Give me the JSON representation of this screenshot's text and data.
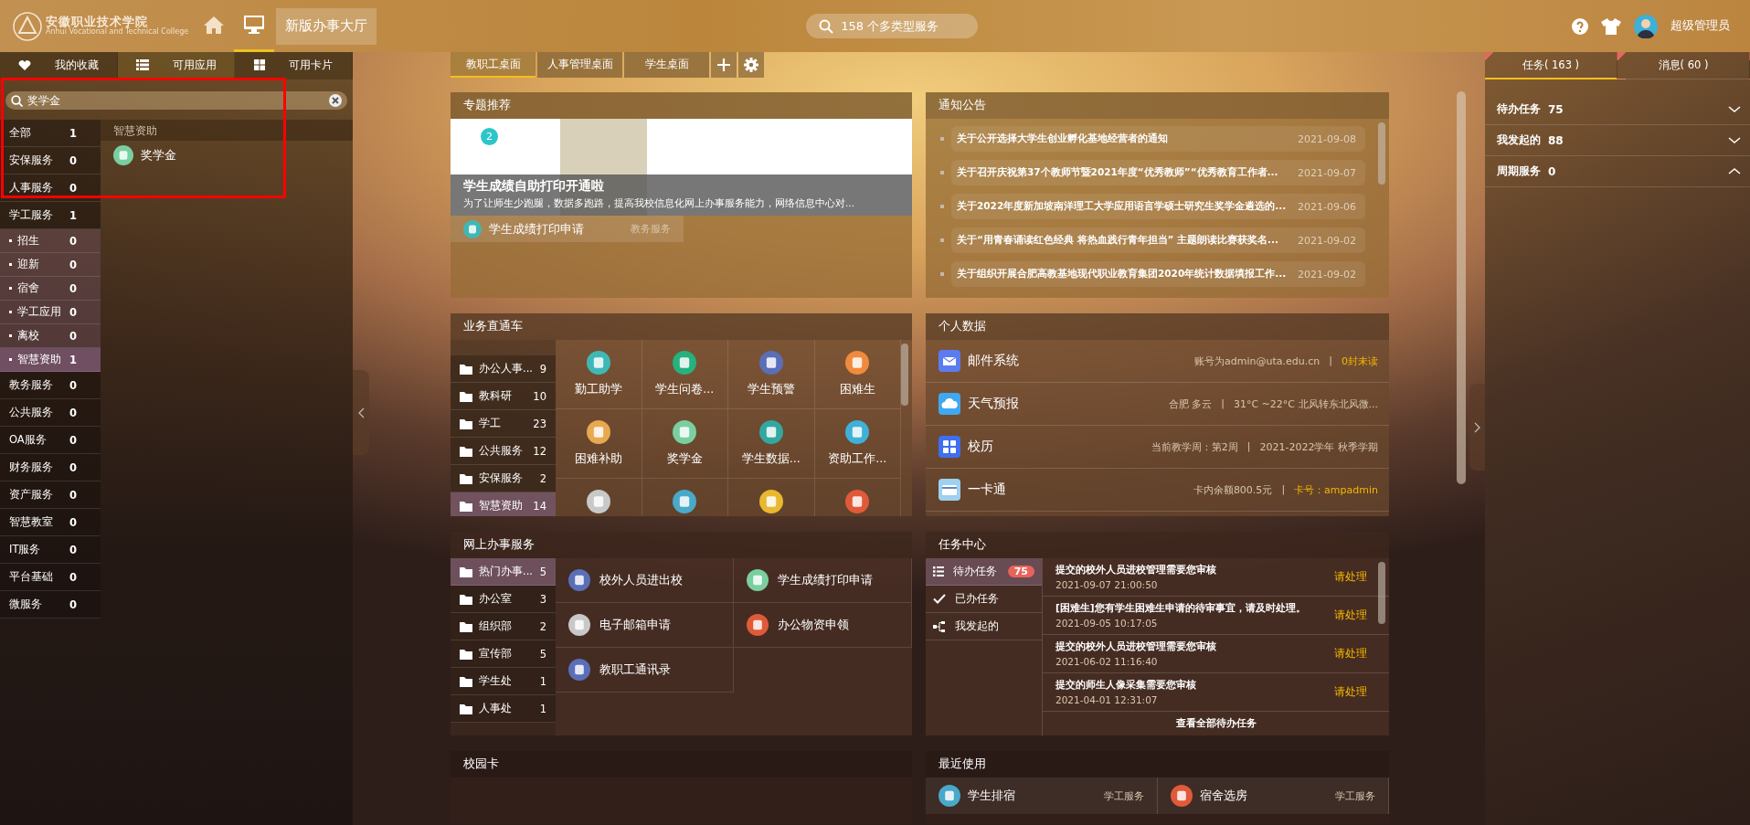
{
  "header": {
    "logo": {
      "name": "安徽职业技术学院",
      "subtitle": "Anhui Vocational and Technical College"
    },
    "nav": [
      {
        "kind": "home",
        "selected": false
      },
      {
        "kind": "desktop",
        "selected": true
      }
    ],
    "hall_button": "新版办事大厅",
    "search": {
      "placeholder": "158 个多类型服务"
    },
    "user": {
      "name": "超级管理员"
    }
  },
  "left_panel": {
    "tabs": [
      {
        "kind": "heart",
        "label": "我的收藏",
        "selected": false
      },
      {
        "kind": "list",
        "label": "可用应用",
        "selected": true
      },
      {
        "kind": "grid",
        "label": "可用卡片",
        "selected": false
      }
    ],
    "search": {
      "value": "奖学金"
    },
    "categories": [
      {
        "kind": "group",
        "name": "全部",
        "count": "1",
        "selected": false
      },
      {
        "kind": "group",
        "name": "安保服务",
        "count": "0",
        "selected": false
      },
      {
        "kind": "group",
        "name": "人事服务",
        "count": "0",
        "selected": false
      },
      {
        "kind": "group",
        "name": "学工服务",
        "count": "1",
        "selected": false
      },
      {
        "kind": "sub",
        "name": "招生",
        "count": "0",
        "selected": false
      },
      {
        "kind": "sub",
        "name": "迎新",
        "count": "0",
        "selected": false
      },
      {
        "kind": "sub",
        "name": "宿舍",
        "count": "0",
        "selected": false
      },
      {
        "kind": "sub",
        "name": "学工应用",
        "count": "0",
        "selected": false
      },
      {
        "kind": "sub",
        "name": "离校",
        "count": "0",
        "selected": false
      },
      {
        "kind": "sub",
        "name": "智慧资助",
        "count": "1",
        "selected": true
      },
      {
        "kind": "group",
        "name": "教务服务",
        "count": "0",
        "selected": false
      },
      {
        "kind": "group",
        "name": "公共服务",
        "count": "0",
        "selected": false
      },
      {
        "kind": "group",
        "name": "OA服务",
        "count": "0",
        "selected": false
      },
      {
        "kind": "group",
        "name": "财务服务",
        "count": "0",
        "selected": false
      },
      {
        "kind": "group",
        "name": "资产服务",
        "count": "0",
        "selected": false
      },
      {
        "kind": "group",
        "name": "智慧教室",
        "count": "0",
        "selected": false
      },
      {
        "kind": "group",
        "name": "IT服务",
        "count": "0",
        "selected": false
      },
      {
        "kind": "group",
        "name": "平台基础",
        "count": "0",
        "selected": false
      },
      {
        "kind": "group",
        "name": "微服务",
        "count": "0",
        "selected": false
      }
    ],
    "results": {
      "group": "智慧资助",
      "apps": [
        {
          "name": "奖学金"
        }
      ]
    }
  },
  "desk_tabs": [
    {
      "label": "教职工桌面",
      "selected": true
    },
    {
      "label": "人事管理桌面",
      "selected": false
    },
    {
      "label": "学生桌面",
      "selected": false
    }
  ],
  "featured": {
    "title": "专题推荐",
    "badge": "2",
    "headline": "学生成绩自助打印开通啦",
    "summary": "为了让师生少跑腿，数据多跑路，提高我校信息化网上办事服务能力，网络信息中心对...",
    "link": {
      "name": "学生成绩打印申请",
      "category": "教务服务"
    }
  },
  "notices": {
    "title": "通知公告",
    "items": [
      {
        "text": "关于公开选择大学生创业孵化基地经营者的通知",
        "date": "2021-09-08"
      },
      {
        "text": "关于召开庆祝第37个教师节暨2021年度“优秀教师”“优秀教育工作者...",
        "date": "2021-09-07"
      },
      {
        "text": "关于2022年度新加坡南洋理工大学应用语言学硕士研究生奖学金遴选的...",
        "date": "2021-09-06"
      },
      {
        "text": "关于“用青春诵读红色经典 将热血践行青年担当” 主题朗读比赛获奖名...",
        "date": "2021-09-02"
      },
      {
        "text": "关于组织开展合肥高教基地现代职业教育集团2020年统计数据填报工作...",
        "date": "2021-09-02"
      }
    ]
  },
  "shortcuts": {
    "title": "业务直通车",
    "categories": [
      {
        "name": "办公人事...",
        "count": "9",
        "selected": false
      },
      {
        "name": "教科研",
        "count": "10",
        "selected": false
      },
      {
        "name": "学工",
        "count": "23",
        "selected": false
      },
      {
        "name": "公共服务",
        "count": "12",
        "selected": false
      },
      {
        "name": "安保服务",
        "count": "2",
        "selected": false
      },
      {
        "name": "智慧资助",
        "count": "14",
        "selected": true
      }
    ],
    "apps": [
      {
        "kind": "labeled",
        "name": "勤工助学"
      },
      {
        "kind": "labeled",
        "name": "学生问卷..."
      },
      {
        "kind": "labeled",
        "name": "学生预警"
      },
      {
        "kind": "labeled",
        "name": "困难生"
      },
      {
        "kind": "labeled",
        "name": "困难补助"
      },
      {
        "kind": "labeled",
        "name": "奖学金"
      },
      {
        "kind": "labeled",
        "name": "学生数据..."
      },
      {
        "kind": "labeled",
        "name": "资助工作..."
      },
      {
        "kind": "icon"
      },
      {
        "kind": "icon"
      },
      {
        "kind": "icon"
      },
      {
        "kind": "icon"
      }
    ]
  },
  "personal": {
    "title": "个人数据",
    "rows": [
      {
        "kind": "mail",
        "name": "邮件系统",
        "details": [
          {
            "text": "账号为admin@uta.edu.cn",
            "highlight": false
          },
          {
            "text": "|",
            "highlight": false
          },
          {
            "text": "0封未读",
            "highlight": true
          }
        ]
      },
      {
        "kind": "weather",
        "name": "天气预报",
        "details": [
          {
            "text": "合肥 多云",
            "highlight": false
          },
          {
            "text": "|",
            "highlight": false
          },
          {
            "text": "31°C ~22°C 北风转东北风微...",
            "highlight": false
          }
        ]
      },
      {
        "kind": "calendar",
        "name": "校历",
        "details": [
          {
            "text": "当前教学周：第2周",
            "highlight": false
          },
          {
            "text": "|",
            "highlight": false
          },
          {
            "text": "2021-2022学年 秋季学期",
            "highlight": false
          }
        ]
      },
      {
        "kind": "card",
        "name": "一卡通",
        "details": [
          {
            "text": "卡内余额800.5元",
            "highlight": false
          },
          {
            "text": "|",
            "highlight": false
          },
          {
            "text": "卡号：ampadmin",
            "highlight": true
          }
        ]
      }
    ]
  },
  "online": {
    "title": "网上办事服务",
    "categories": [
      {
        "name": "热门办事...",
        "count": "5",
        "selected": true
      },
      {
        "name": "办公室",
        "count": "3",
        "selected": false
      },
      {
        "name": "组织部",
        "count": "2",
        "selected": false
      },
      {
        "name": "宣传部",
        "count": "5",
        "selected": false
      },
      {
        "name": "学生处",
        "count": "1",
        "selected": false
      },
      {
        "name": "人事处",
        "count": "1",
        "selected": false
      }
    ],
    "apps": [
      {
        "name": "校外人员进出校"
      },
      {
        "name": "学生成绩打印申请"
      },
      {
        "name": "电子邮箱申请"
      },
      {
        "name": "办公物资申领"
      },
      {
        "name": "教职工通讯录"
      }
    ]
  },
  "tasks": {
    "title": "任务中心",
    "menu": [
      {
        "kind": "todo",
        "label": "待办任务",
        "badge": "75",
        "selected": true
      },
      {
        "kind": "done",
        "label": "已办任务",
        "selected": false
      },
      {
        "kind": "started",
        "label": "我发起的",
        "selected": false
      }
    ],
    "items": [
      {
        "title": "提交的校外人员进校管理需要您审核",
        "time": "2021-09-07 21:00:50",
        "action": "请处理"
      },
      {
        "title": "[困难生]您有学生困难生申请的待审事宜，请及时处理。",
        "time": "2021-09-05 10:17:05",
        "action": "请处理"
      },
      {
        "title": "提交的校外人员进校管理需要您审核",
        "time": "2021-06-02 11:16:40",
        "action": "请处理"
      },
      {
        "title": "提交的师生人像采集需要您审核",
        "time": "2021-04-01 12:31:07",
        "action": "请处理"
      }
    ],
    "footer": "查看全部待办任务"
  },
  "campus_card": {
    "title": "校园卡"
  },
  "recent": {
    "title": "最近使用",
    "items": [
      {
        "name": "学生排宿",
        "category": "学工服务"
      },
      {
        "name": "宿舍选房",
        "category": "学工服务"
      }
    ]
  },
  "right_panel": {
    "tabs": [
      {
        "label": "任务( 163 )",
        "selected": true
      },
      {
        "label": "消息( 60 )",
        "selected": false
      }
    ],
    "sections": [
      {
        "label": "待办任务",
        "count": "75",
        "expanded": false
      },
      {
        "label": "我发起的",
        "count": "88",
        "expanded": false
      },
      {
        "label": "周期服务",
        "count": "0",
        "expanded": true
      }
    ]
  }
}
